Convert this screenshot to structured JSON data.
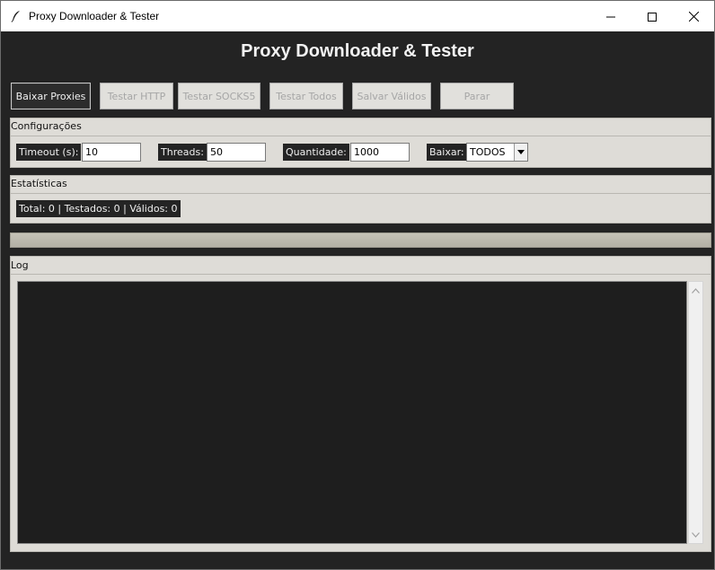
{
  "window": {
    "title": "Proxy Downloader & Tester",
    "icon": "feather-icon",
    "controls": [
      "minimize-icon",
      "maximize-icon",
      "close-icon"
    ]
  },
  "header": {
    "title": "Proxy Downloader & Tester"
  },
  "toolbar": {
    "download_label": "Baixar Proxies",
    "test_http_label": "Testar HTTP",
    "test_socks5_label": "Testar SOCKS5",
    "test_all_label": "Testar Todos",
    "save_valid_label": "Salvar Válidos",
    "stop_label": "Parar"
  },
  "config": {
    "section_label": "Configurações",
    "timeout_label": "Timeout (s):",
    "timeout_value": "10",
    "threads_label": "Threads:",
    "threads_value": "50",
    "quantity_label": "Quantidade:",
    "quantity_value": "1000",
    "download_type_label": "Baixar:",
    "download_type_value": "TODOS"
  },
  "stats": {
    "section_label": "Estatísticas",
    "summary": "Total: 0 | Testados: 0 | Válidos: 0"
  },
  "progress": {
    "value_percent": 0
  },
  "log": {
    "section_label": "Log",
    "content": ""
  },
  "colors": {
    "window_bg": "#232323",
    "frame_bg": "#dedcd7",
    "button_disabled_text": "#a6a6a6",
    "log_bg": "#1e1e1e"
  }
}
